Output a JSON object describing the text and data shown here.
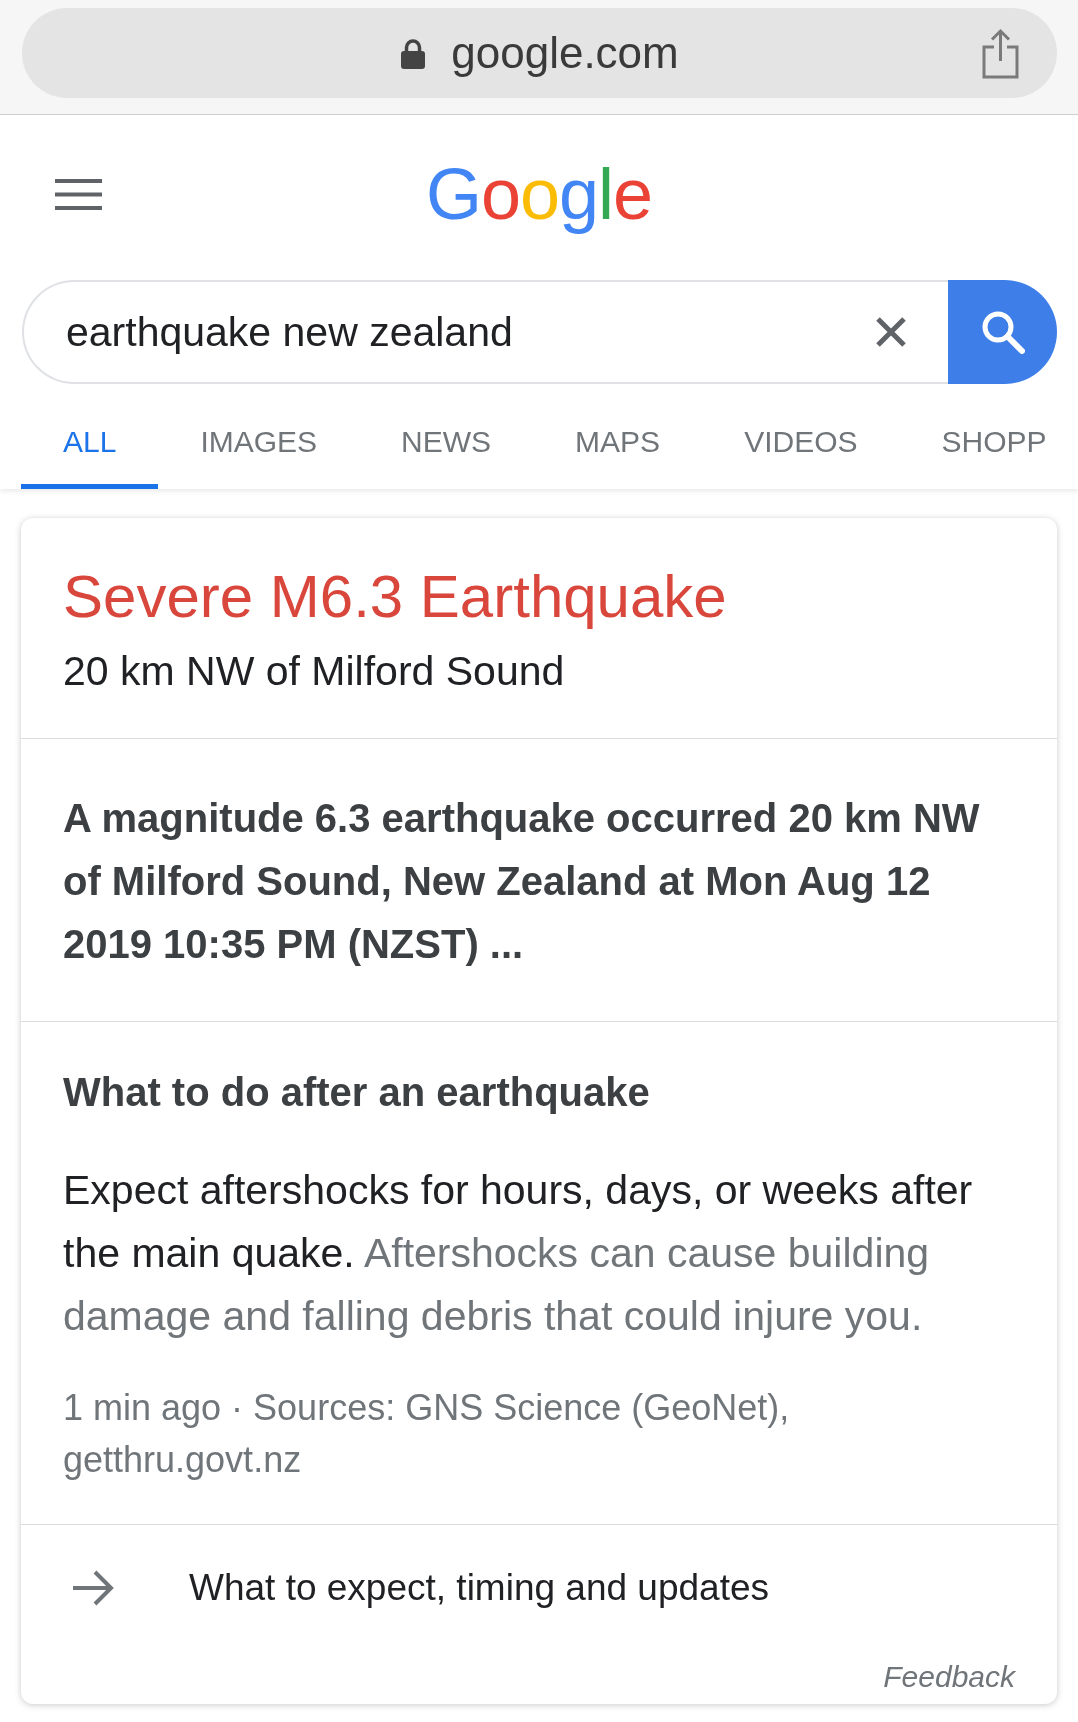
{
  "address_bar": {
    "url": "google.com"
  },
  "header": {
    "logo": "Google"
  },
  "search": {
    "value": "earthquake new zealand"
  },
  "tabs": [
    {
      "label": "ALL",
      "selected": true
    },
    {
      "label": "IMAGES",
      "selected": false
    },
    {
      "label": "NEWS",
      "selected": false
    },
    {
      "label": "MAPS",
      "selected": false
    },
    {
      "label": "VIDEOS",
      "selected": false
    },
    {
      "label": "SHOPP",
      "selected": false
    }
  ],
  "alert_card": {
    "title": "Severe M6.3 Earthquake",
    "location": "20 km NW of Milford Sound",
    "summary": "A magnitude 6.3 earthquake occurred 20 km NW of Milford Sound, New Zealand at Mon Aug 12 2019 10:35 PM (NZST) ...",
    "advice": {
      "heading": "What to do after an earthquake",
      "body": [
        {
          "text": "Expect aftershocks for hours, days, or weeks after the main quake.",
          "muted": false
        },
        {
          "text": "Aftershocks can cause building damage and falling debris that could injure you.",
          "muted": true
        }
      ],
      "sources": "1 min ago · Sources: GNS Science (GeoNet), getthru.govt.nz"
    },
    "link": "What to expect, timing and updates",
    "feedback": "Feedback"
  }
}
